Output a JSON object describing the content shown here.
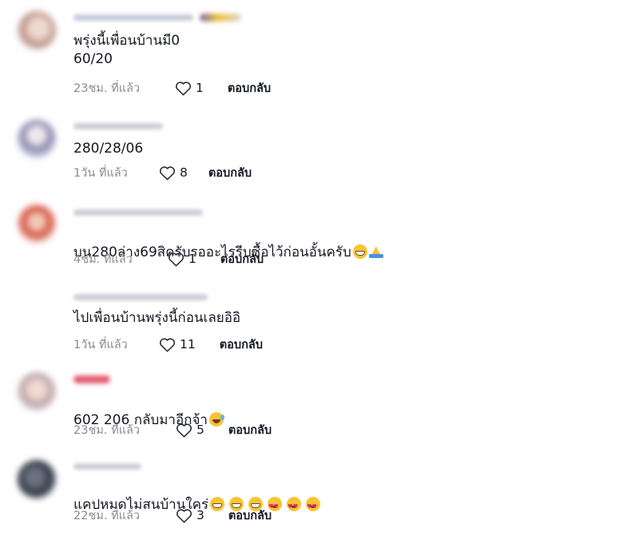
{
  "comments": [
    {
      "text": "พรุ่งนี้เพื่อนบ้านมี0\n60/20",
      "time": "23ชม. ที่แล้ว",
      "likes": "1",
      "reply": "ตอบกลับ",
      "emojis": []
    },
    {
      "text": "280/28/06",
      "time": "1วัน ที่แล้ว",
      "likes": "8",
      "reply": "ตอบกลับ",
      "emojis": []
    },
    {
      "text": "บน280ล่าง69สิครับรออะไรรีบซื้อไว้ก่อนอั้นครับ",
      "time": "4ชม. ที่แล้ว",
      "likes": "1",
      "reply": "ตอบกลับ",
      "emojis": [
        "grin-icon",
        "pray-icon"
      ]
    },
    {
      "text": "ไปเพื่อนบ้านพรุ่งนี้ก่อนเลยอิอิ",
      "time": "1วัน ที่แล้ว",
      "likes": "11",
      "reply": "ตอบกลับ",
      "emojis": []
    },
    {
      "text": "602 206 กลับมาอีกจ้า",
      "time": "23ชม. ที่แล้ว",
      "likes": "5",
      "reply": "ตอบกลับ",
      "emojis": [
        "tears-of-joy-icon"
      ]
    },
    {
      "text": "แคปหมดไม่สนบ้านใคร่",
      "time": "22ชม. ที่แล้ว",
      "likes": "3",
      "reply": "ตอบกลับ",
      "emojis": [
        "grin-icon",
        "grin-icon",
        "grin-icon",
        "smiling-hearts-icon",
        "smiling-hearts-icon",
        "smiling-hearts-icon"
      ]
    }
  ],
  "colors": {
    "text": "#161823",
    "meta": "#8a8b91",
    "background": "#ffffff"
  }
}
